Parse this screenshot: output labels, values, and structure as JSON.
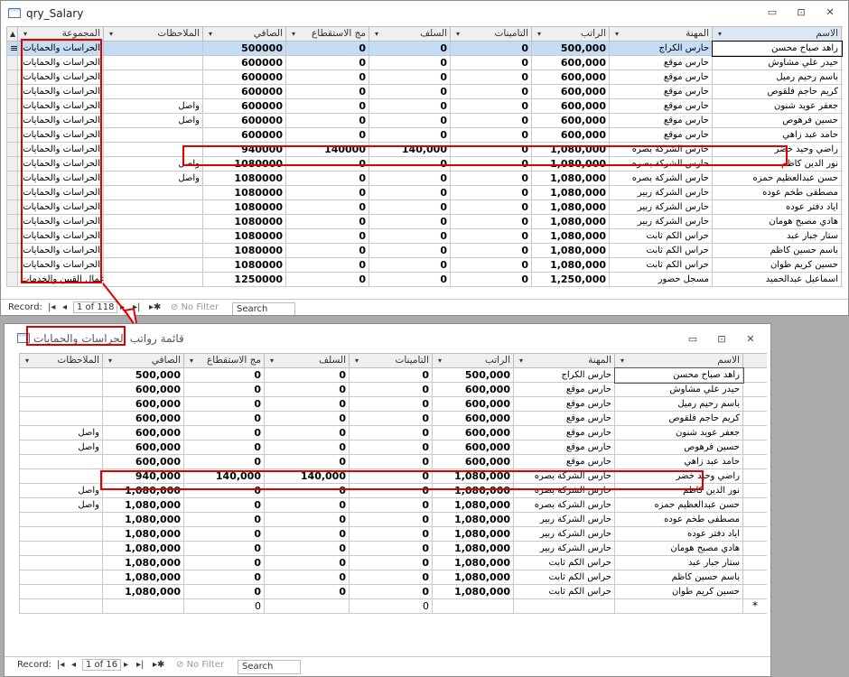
{
  "window1": {
    "title": "qry_Salary",
    "headers": [
      "الاسم",
      "المهنة",
      "الراتب",
      "التامينات",
      "السلف",
      "مج الاستقطاع",
      "الصافي",
      "الملاحظات",
      "المجموعة"
    ],
    "rows": [
      [
        "راهد صباح محسن",
        "حارس الكراج",
        "500,000",
        "0",
        "0",
        "0",
        "500000",
        "",
        "الحراسات والحمايات"
      ],
      [
        "حيدر علي مشاوش",
        "حارس موقع",
        "600,000",
        "0",
        "0",
        "0",
        "600000",
        "",
        "الحراسات والحمايات"
      ],
      [
        "باسم رحيم رميل",
        "حارس موقع",
        "600,000",
        "0",
        "0",
        "0",
        "600000",
        "",
        "الحراسات والحمايات"
      ],
      [
        "كريم حاجم فلقوص",
        "حارس موقع",
        "600,000",
        "0",
        "0",
        "0",
        "600000",
        "",
        "الحراسات والحمايات"
      ],
      [
        "جعفر عويد شنون",
        "حارس موقع",
        "600,000",
        "0",
        "0",
        "0",
        "600000",
        "واصل",
        "الحراسات والحمايات"
      ],
      [
        "حسين فرهوص",
        "حارس موقع",
        "600,000",
        "0",
        "0",
        "0",
        "600000",
        "واصل",
        "الحراسات والحمايات"
      ],
      [
        "حامد عبد زاهي",
        "حارس موقع",
        "600,000",
        "0",
        "0",
        "0",
        "600000",
        "",
        "الحراسات والحمايات"
      ],
      [
        "راضي وحيد خضر",
        "حارس الشركة بصره",
        "1,080,000",
        "0",
        "140,000",
        "140000",
        "940000",
        "",
        "الحراسات والحمايات"
      ],
      [
        "نور الدين كاظم",
        "حارس الشركة بصره",
        "1,080,000",
        "0",
        "0",
        "0",
        "1080000",
        "واصل",
        "الحراسات والحمايات"
      ],
      [
        "حسن عبدالعظيم حمزه",
        "حارس الشركة بصره",
        "1,080,000",
        "0",
        "0",
        "0",
        "1080000",
        "واصل",
        "الحراسات والحمايات"
      ],
      [
        "مصطفى طخم عوده",
        "حارس الشركة ربير",
        "1,080,000",
        "0",
        "0",
        "0",
        "1080000",
        "",
        "الحراسات والحمايات"
      ],
      [
        "اياد دفتر عوده",
        "حارس الشركة ربير",
        "1,080,000",
        "0",
        "0",
        "0",
        "1080000",
        "",
        "الحراسات والحمايات"
      ],
      [
        "هادي مصبح هومان",
        "حارس الشركة ربير",
        "1,080,000",
        "0",
        "0",
        "0",
        "1080000",
        "",
        "الحراسات والحمايات"
      ],
      [
        "ستار جبار عبد",
        "حراس الكم ثابت",
        "1,080,000",
        "0",
        "0",
        "0",
        "1080000",
        "",
        "الحراسات والحمايات"
      ],
      [
        "باسم حسين كاظم",
        "حراس الكم ثابت",
        "1,080,000",
        "0",
        "0",
        "0",
        "1080000",
        "",
        "الحراسات والحمايات"
      ],
      [
        "حسين كريم طوان",
        "حراس الكم ثابت",
        "1,080,000",
        "0",
        "0",
        "0",
        "1080000",
        "",
        "الحراسات والحمايات"
      ],
      [
        "اسماعيل عبدالحميد",
        "مسجل حضور",
        "1,250,000",
        "0",
        "0",
        "0",
        "1250000",
        "",
        "عمال القبين والخدمات"
      ]
    ],
    "status": {
      "record_label": "Record:",
      "position": "1 of 118",
      "filter": "No Filter",
      "search": "Search"
    }
  },
  "window2": {
    "title": "قائمة رواتب الحراسات والحمايات",
    "headers": [
      "الاسم",
      "المهنة",
      "الراتب",
      "التامينات",
      "السلف",
      "مج الاستقطاع",
      "الصافي",
      "الملاحظات"
    ],
    "rows": [
      [
        "راهد صباح محسن",
        "حارس الكراج",
        "500,000",
        "0",
        "0",
        "0",
        "500,000",
        ""
      ],
      [
        "حيدر علي مشاوش",
        "حارس موقع",
        "600,000",
        "0",
        "0",
        "0",
        "600,000",
        ""
      ],
      [
        "باسم رحيم رميل",
        "حارس موقع",
        "600,000",
        "0",
        "0",
        "0",
        "600,000",
        ""
      ],
      [
        "كريم حاجم فلقوص",
        "حارس موقع",
        "600,000",
        "0",
        "0",
        "0",
        "600,000",
        ""
      ],
      [
        "جعفر عويد شنون",
        "حارس موقع",
        "600,000",
        "0",
        "0",
        "0",
        "600,000",
        "واصل"
      ],
      [
        "حسين فرهوص",
        "حارس موقع",
        "600,000",
        "0",
        "0",
        "0",
        "600,000",
        "واصل"
      ],
      [
        "حامد عبد زاهي",
        "حارس موقع",
        "600,000",
        "0",
        "0",
        "0",
        "600,000",
        ""
      ],
      [
        "راضي وحيد خضر",
        "حارس الشركة بصره",
        "1,080,000",
        "0",
        "140,000",
        "140,000",
        "940,000",
        ""
      ],
      [
        "نور الدين كاظم",
        "حارس الشركة بصره",
        "1,080,000",
        "0",
        "0",
        "0",
        "1,080,000",
        "واصل"
      ],
      [
        "حسن عبدالعظيم حمزه",
        "حارس الشركة بصره",
        "1,080,000",
        "0",
        "0",
        "0",
        "1,080,000",
        "واصل"
      ],
      [
        "مصطفى طخم عوده",
        "حارس الشركة ربير",
        "1,080,000",
        "0",
        "0",
        "0",
        "1,080,000",
        ""
      ],
      [
        "اياد دفتر عوده",
        "حارس الشركة ربير",
        "1,080,000",
        "0",
        "0",
        "0",
        "1,080,000",
        ""
      ],
      [
        "هادي مصبح هومان",
        "حارس الشركة ربير",
        "1,080,000",
        "0",
        "0",
        "0",
        "1,080,000",
        ""
      ],
      [
        "ستار جبار عبد",
        "حراس الكم ثابت",
        "1,080,000",
        "0",
        "0",
        "0",
        "1,080,000",
        ""
      ],
      [
        "باسم حسين كاظم",
        "حراس الكم ثابت",
        "1,080,000",
        "0",
        "0",
        "0",
        "1,080,000",
        ""
      ],
      [
        "حسين كريم طوان",
        "حراس الكم ثابت",
        "1,080,000",
        "0",
        "0",
        "0",
        "1,080,000",
        ""
      ]
    ],
    "new_row": [
      "",
      "",
      "",
      "0",
      "",
      "0",
      "",
      ""
    ],
    "new_row_marker": "*",
    "status": {
      "record_label": "Record:",
      "position": "1 of 16",
      "filter": "No Filter",
      "search": "Search"
    }
  },
  "icons": {
    "minimize": "minimize-icon",
    "maximize": "maximize-icon",
    "close": "close-icon",
    "table": "table-icon"
  },
  "colors": {
    "highlight": "#e00000",
    "selected_row": "#c4dcf4"
  }
}
